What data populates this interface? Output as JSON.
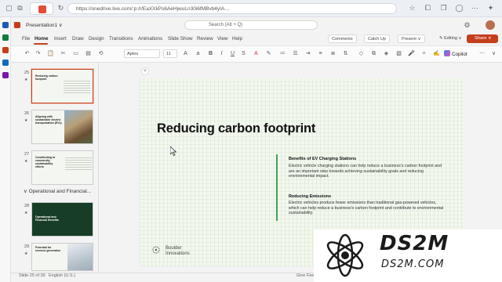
{
  "browser": {
    "url": "https://onedrive.live.com/:p:/r/EaXXkPs6AeHjwuLn30i6fMBvb4yIA…",
    "tab_title": "Presentation1"
  },
  "app": {
    "doc_title": "Presentation1 ∨",
    "search_text": "Search (Alt + Q)"
  },
  "menu": {
    "items": [
      "File",
      "Home",
      "Insert",
      "Draw",
      "Design",
      "Transitions",
      "Animations",
      "Slide Show",
      "Review",
      "View",
      "Help"
    ],
    "active": "Home",
    "comments": "Comments",
    "catchup": "Catch Up",
    "present": "Present",
    "editing": "Editing",
    "share": "Share"
  },
  "toolbar": {
    "font": "Aptos",
    "size": "11",
    "copilot": "Copilot"
  },
  "slides_panel": {
    "slides": [
      {
        "num": "25",
        "title": "Reducing carbon footprint"
      },
      {
        "num": "26",
        "title": "Aligning with sustainable electric transportation (EVs)"
      },
      {
        "num": "27",
        "title": "Contributing to community sustainability efforts"
      },
      {
        "num": "28",
        "title": "Operational and Financial Benefits"
      },
      {
        "num": "29",
        "title": "Potential for revenue generation"
      }
    ],
    "section_label": "Operational and Financial..."
  },
  "slide": {
    "title": "Reducing carbon footprint",
    "h1": "Benefits of EV Charging Stations",
    "p1": "Electric vehicle charging stations can help reduce a business's carbon footprint and are an important step towards achieving sustainability goals and reducing environmental impact.",
    "h2": "Reducing Emissions",
    "p2": "Electric vehicles produce fewer emissions than traditional gas-powered vehicles, which can help reduce a business's carbon footprint and contribute to environmental sustainability.",
    "logo_text": "Boulder Innovations"
  },
  "status": {
    "slide_count": "Slide 25 of 36",
    "language": "English (U.S.)",
    "feedback": "Give Feedback"
  },
  "watermark": {
    "main": "DS2M",
    "sub": "DS2M.COM"
  },
  "colors": {
    "accent": "#c43e1c",
    "green_line": "#3ea355"
  }
}
